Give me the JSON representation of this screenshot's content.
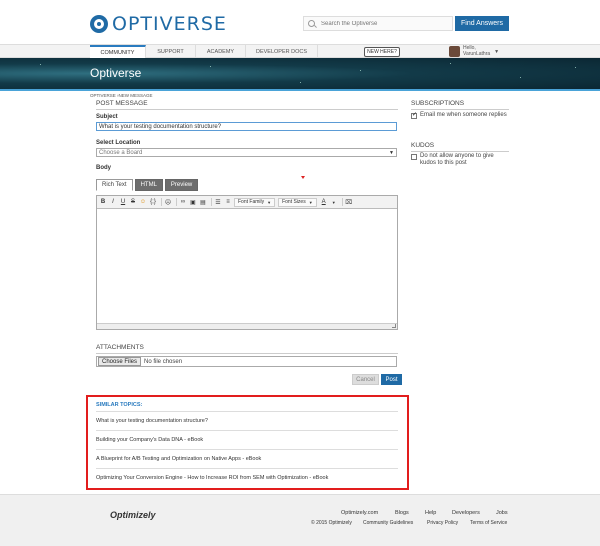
{
  "header": {
    "logo_text": "OPTIVERSE",
    "search_placeholder": "Search the Optiverse",
    "find_button": "Find Answers"
  },
  "nav": {
    "items": [
      "COMMUNITY",
      "SUPPORT",
      "ACADEMY",
      "DEVELOPER DOCS"
    ],
    "active": "COMMUNITY",
    "new_here": "NEW HERE?",
    "greeting": "Hello,",
    "username": "VarunLathra"
  },
  "banner": {
    "title": "Optiverse"
  },
  "breadcrumb": "OPTIVERSE ›NEW MESSAGE",
  "form": {
    "section_title": "POST MESSAGE",
    "subject_label": "Subject",
    "subject_value": "What is your testing documentation structure?",
    "location_label": "Select Location",
    "location_value": "Choose a Board",
    "body_label": "Body",
    "tabs": [
      "Rich Text",
      "HTML",
      "Preview"
    ],
    "toolbar": {
      "font_family": "Font Family",
      "font_sizes": "Font Sizes"
    },
    "attachments_title": "ATTACHMENTS",
    "choose_files": "Choose Files",
    "no_file": "No file chosen",
    "cancel": "Cancel",
    "post": "Post"
  },
  "similar": {
    "title": "SIMILAR TOPICS:",
    "items": [
      "What is your testing documentation structure?",
      "Building your Company's Data DNA - eBook",
      "A Blueprint for A/B Testing and Optimization on Native Apps - eBook",
      "Optimizing Your Conversion Engine - How to Increase ROI from SEM with Optimization - eBook"
    ]
  },
  "sidebar": {
    "subscriptions_title": "SUBSCRIPTIONS",
    "subscriptions_option": "Email me when someone replies",
    "subscriptions_checked": true,
    "kudos_title": "KUDOS",
    "kudos_option": "Do not allow anyone to give kudos to this post",
    "kudos_checked": false
  },
  "footer": {
    "logo": "Optimizely",
    "links": [
      "Optimizely.com",
      "Blogs",
      "Help",
      "Developers",
      "Jobs"
    ],
    "copyright": "© 2015 Optimizely",
    "sublinks": [
      "Community Guidelines",
      "Privacy Policy",
      "Terms of Service"
    ]
  },
  "colors": {
    "brand": "#1f6aa5",
    "highlight_border": "#e21d1d",
    "banner": "#123a48"
  }
}
